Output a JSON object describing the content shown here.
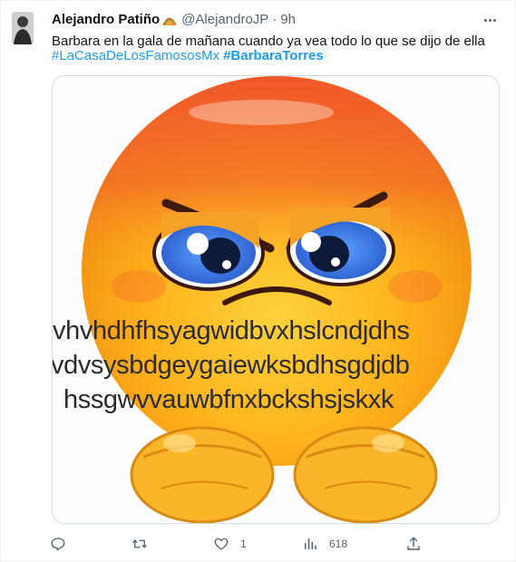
{
  "tweet": {
    "author_name": "Alejandro Patiño",
    "author_handle": "@AlejandroJP",
    "separator": "·",
    "time": "9h",
    "text": "Barbara en la gala de mañana cuando ya vea todo lo que se dijo de ella",
    "hashtags": [
      "#LaCasaDeLosFamososMx",
      "#BarbaraTorres"
    ],
    "icons": {
      "more": "more-horizontal-icon",
      "name_badge": "taco-emoji-icon",
      "reply": "reply-icon",
      "retweet": "retweet-icon",
      "like": "like-icon",
      "views": "views-icon",
      "share": "share-icon"
    }
  },
  "media": {
    "meme_lines": [
      "jvhvhdhfhsyagwidbvxhslcndjdhs",
      "vdvsysbdgeygaiewksbdhsgdjdb",
      "hssgwvvauwbfnxbckshsjskxk"
    ]
  },
  "actions": {
    "reply_count": "",
    "retweet_count": "",
    "like_count": "1",
    "views_count": "618"
  },
  "colors": {
    "text": "#0f1419",
    "secondary": "#536471",
    "link": "#1d9bf0",
    "border": "#cfd9de"
  }
}
